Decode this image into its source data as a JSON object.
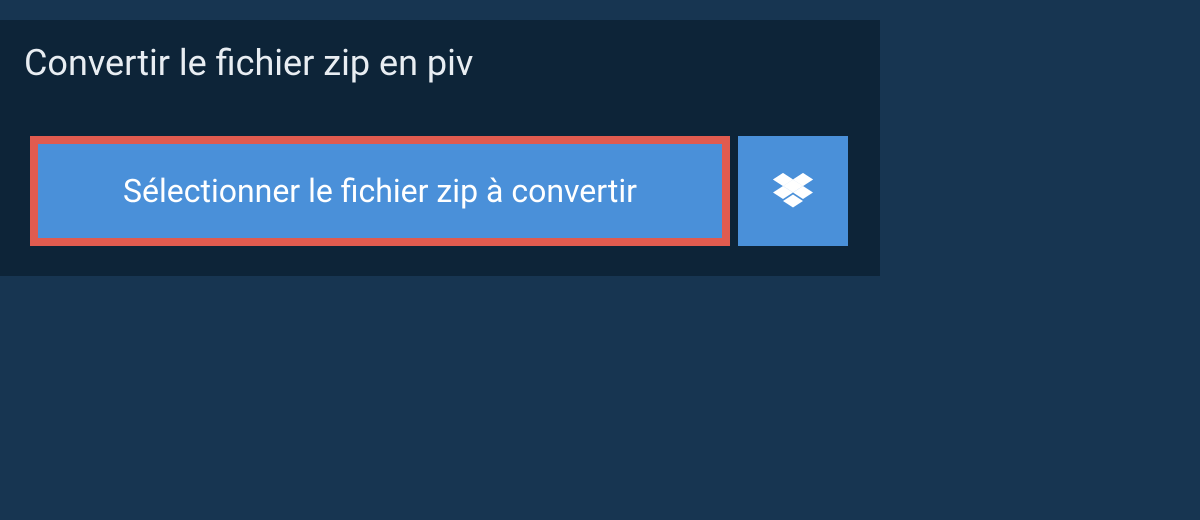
{
  "header": {
    "title": "Convertir le fichier zip en piv"
  },
  "actions": {
    "select_file_label": "Sélectionner le fichier zip à convertir"
  },
  "colors": {
    "background": "#173551",
    "card": "#0d2438",
    "button": "#4a90d9",
    "highlight_border": "#e05b4f"
  }
}
